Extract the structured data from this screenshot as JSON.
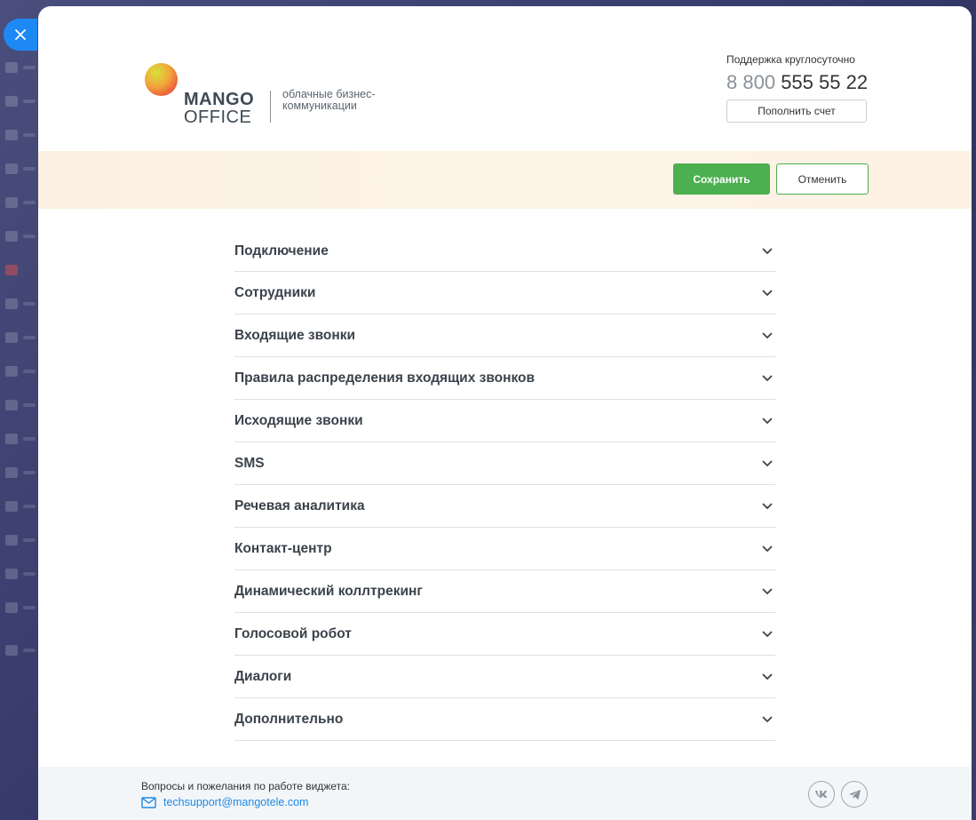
{
  "logo": {
    "mango": "MANGO",
    "office": "OFFICE",
    "tagline": "облачные бизнес-коммуникации"
  },
  "support": {
    "label": "Поддержка круглосуточно",
    "phone_prefix": "8 800",
    "phone_number": "555 55 22",
    "topup_label": "Пополнить счет"
  },
  "actions": {
    "save_label": "Сохранить",
    "cancel_label": "Отменить"
  },
  "sections": [
    "Подключение",
    "Сотрудники",
    "Входящие звонки",
    "Правила распределения входящих звонков",
    "Исходящие звонки",
    "SMS",
    "Речевая аналитика",
    "Контакт-центр",
    "Динамический коллтрекинг",
    "Голосовой робот",
    "Диалоги",
    "Дополнительно"
  ],
  "footer": {
    "text": "Вопросы и пожелания по работе виджета:",
    "email": "techsupport@mangotele.com",
    "social": [
      "vk-icon",
      "telegram-icon"
    ]
  },
  "colors": {
    "primary_green": "#4caf50",
    "close_blue": "#1e88f5",
    "link_blue": "#1e88e5"
  },
  "icons": {
    "close": "close-icon",
    "chevron": "chevron-down-icon",
    "mail": "mail-icon"
  }
}
